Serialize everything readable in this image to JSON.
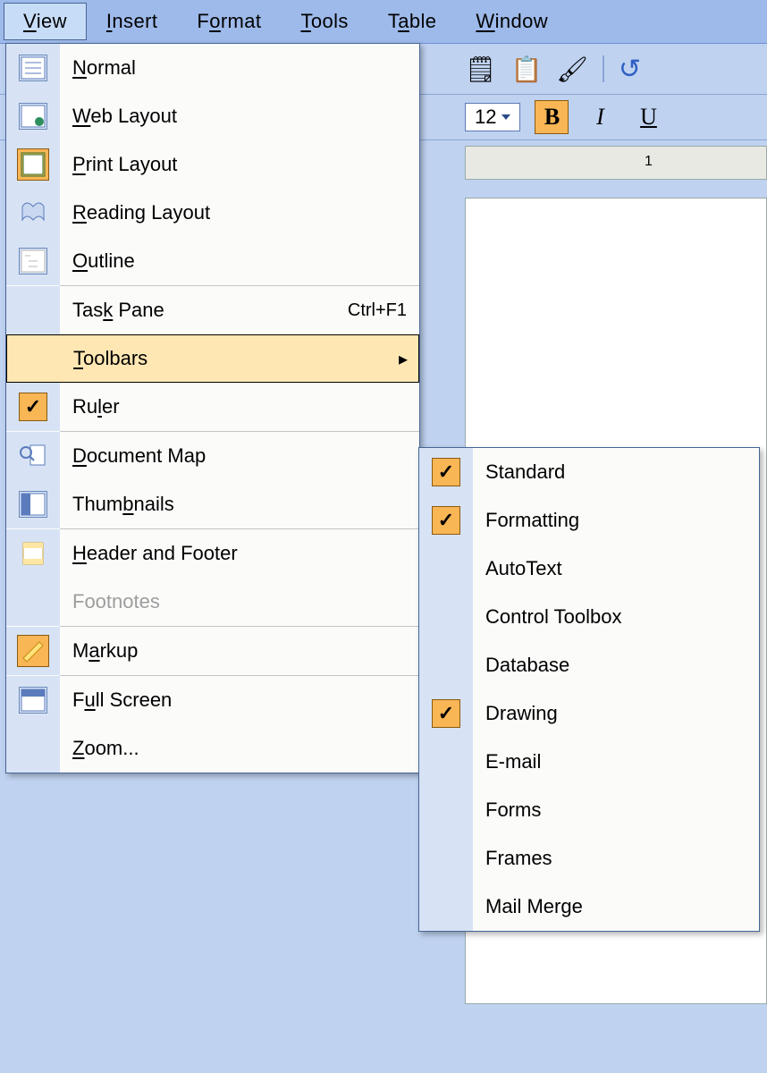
{
  "menubar": {
    "items": [
      {
        "label": "View",
        "key": "V"
      },
      {
        "label": "Insert",
        "key": "I"
      },
      {
        "label": "Format",
        "key": "o"
      },
      {
        "label": "Tools",
        "key": "T"
      },
      {
        "label": "Table",
        "key": "a"
      },
      {
        "label": "Window",
        "key": "W"
      }
    ],
    "active": "View"
  },
  "toolbar": {
    "font_size": "12",
    "buttons": {
      "paste": "📋",
      "clipboard": "🗒",
      "format_painter": "🖌",
      "undo": "↻",
      "bold": "B",
      "italic": "I",
      "underline": "U"
    },
    "active_style": "bold"
  },
  "ruler_label": "1",
  "view_menu": {
    "items": [
      {
        "label": "Normal",
        "key": "N",
        "icon": "normal"
      },
      {
        "label": "Web Layout",
        "key": "W",
        "icon": "web"
      },
      {
        "label": "Print Layout",
        "key": "P",
        "icon": "print",
        "selected": true
      },
      {
        "label": "Reading Layout",
        "key": "R",
        "icon": "reading"
      },
      {
        "label": "Outline",
        "key": "O",
        "icon": "outline"
      },
      {
        "label": "Task Pane",
        "key": "k",
        "shortcut": "Ctrl+F1"
      },
      {
        "label": "Toolbars",
        "key": "T",
        "submenu": true,
        "highlighted": true
      },
      {
        "label": "Ruler",
        "key": "L",
        "checked": true
      },
      {
        "label": "Document Map",
        "key": "D",
        "icon": "docmap"
      },
      {
        "label": "Thumbnails",
        "key": "b",
        "icon": "thumbs"
      },
      {
        "label": "Header and Footer",
        "key": "H",
        "icon": "hf"
      },
      {
        "label": "Footnotes",
        "disabled": true
      },
      {
        "label": "Markup",
        "key": "a",
        "icon": "markup",
        "selected": true
      },
      {
        "label": "Full Screen",
        "key": "u",
        "icon": "fullscreen"
      },
      {
        "label": "Zoom...",
        "key": "Z"
      }
    ]
  },
  "toolbars_submenu": {
    "items": [
      {
        "label": "Standard",
        "checked": true
      },
      {
        "label": "Formatting",
        "checked": true
      },
      {
        "label": "AutoText"
      },
      {
        "label": "Control Toolbox"
      },
      {
        "label": "Database"
      },
      {
        "label": "Drawing",
        "checked": true
      },
      {
        "label": "E-mail"
      },
      {
        "label": "Forms"
      },
      {
        "label": "Frames"
      },
      {
        "label": "Mail Merge"
      }
    ]
  }
}
